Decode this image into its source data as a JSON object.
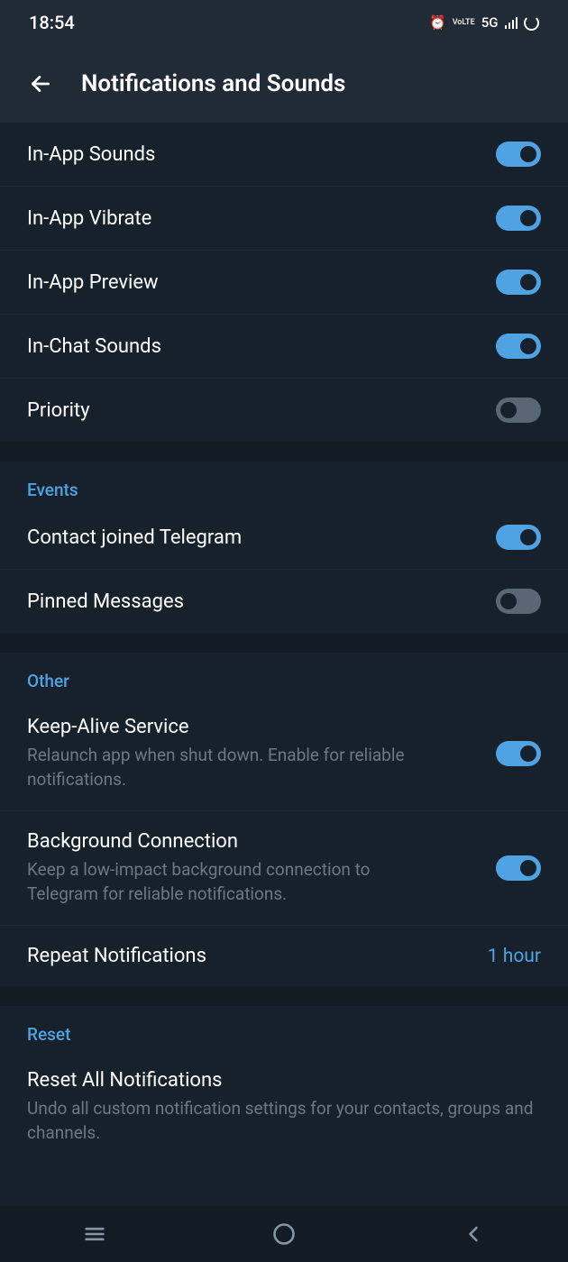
{
  "status": {
    "time": "18:54",
    "network": "5G"
  },
  "header": {
    "title": "Notifications and Sounds"
  },
  "rows": {
    "in_app_sounds": "In-App Sounds",
    "in_app_vibrate": "In-App Vibrate",
    "in_app_preview": "In-App Preview",
    "in_chat_sounds": "In-Chat Sounds",
    "priority": "Priority"
  },
  "sections": {
    "events": "Events",
    "other": "Other",
    "reset": "Reset"
  },
  "events": {
    "contact_joined": "Contact joined Telegram",
    "pinned_messages": "Pinned Messages"
  },
  "other": {
    "keepalive": "Keep-Alive Service",
    "keepalive_sub": "Relaunch app when shut down. Enable for reliable notifications.",
    "bg_conn": "Background Connection",
    "bg_conn_sub": "Keep a low-impact background connection to Telegram for reliable notifications.",
    "repeat": "Repeat Notifications",
    "repeat_value": "1 hour"
  },
  "reset": {
    "reset_all": "Reset All Notifications",
    "reset_sub": "Undo all custom notification settings for your contacts, groups and channels."
  }
}
